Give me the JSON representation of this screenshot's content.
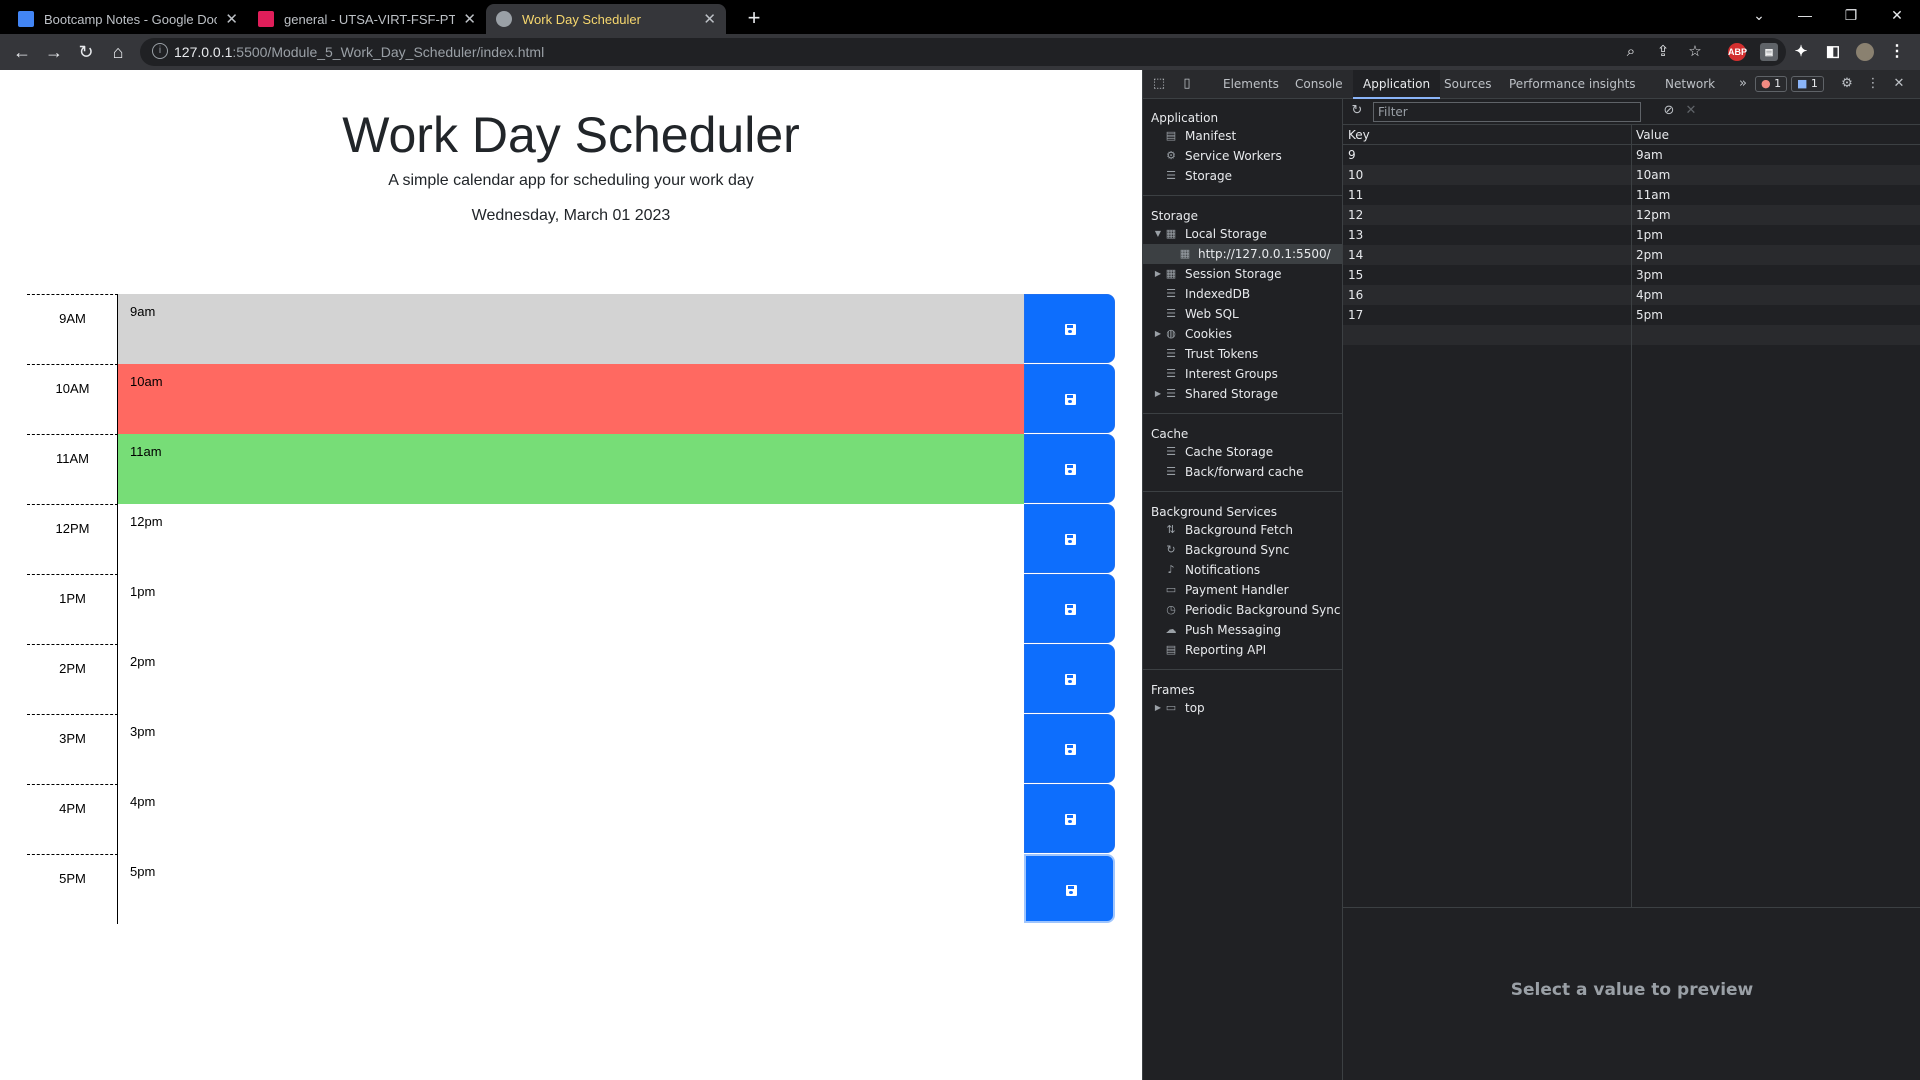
{
  "browser": {
    "tabs": [
      {
        "title": "Bootcamp Notes - Google Docs",
        "favicon_color": "#4285f4"
      },
      {
        "title": "general - UTSA-VIRT-FSF-PT-01-",
        "favicon_color": "#e01e5a"
      },
      {
        "title": "Work Day Scheduler",
        "favicon_color": "#9aa0a6"
      }
    ],
    "url_host": "127.0.0.1",
    "url_rest": ":5500/Module_5_Work_Day_Scheduler/index.html"
  },
  "page": {
    "title": "Work Day Scheduler",
    "subtitle": "A simple calendar app for scheduling your work day",
    "date": "Wednesday, March 01 2023",
    "rows": [
      {
        "hour": "9AM",
        "text": "9am",
        "state": "past"
      },
      {
        "hour": "10AM",
        "text": "10am",
        "state": "present"
      },
      {
        "hour": "11AM",
        "text": "11am",
        "state": "future"
      },
      {
        "hour": "12PM",
        "text": "12pm",
        "state": "none"
      },
      {
        "hour": "1PM",
        "text": "1pm",
        "state": "none"
      },
      {
        "hour": "2PM",
        "text": "2pm",
        "state": "none"
      },
      {
        "hour": "3PM",
        "text": "3pm",
        "state": "none"
      },
      {
        "hour": "4PM",
        "text": "4pm",
        "state": "none"
      },
      {
        "hour": "5PM",
        "text": "5pm",
        "state": "none"
      }
    ],
    "colors": {
      "past": "#d3d3d3",
      "present": "#ff6961",
      "future": "#77dd77",
      "save": "#0d6efd"
    }
  },
  "devtools": {
    "tabs": [
      "Elements",
      "Console",
      "Application",
      "Sources",
      "Performance insights",
      "Network"
    ],
    "active_tab": "Application",
    "error_count": "1",
    "message_count": "1",
    "sections": {
      "application": {
        "title": "Application",
        "items": [
          "Manifest",
          "Service Workers",
          "Storage"
        ]
      },
      "storage": {
        "title": "Storage",
        "items": [
          "Local Storage",
          "http://127.0.0.1:5500/",
          "Session Storage",
          "IndexedDB",
          "Web SQL",
          "Cookies",
          "Trust Tokens",
          "Interest Groups",
          "Shared Storage"
        ]
      },
      "cache": {
        "title": "Cache",
        "items": [
          "Cache Storage",
          "Back/forward cache"
        ]
      },
      "background": {
        "title": "Background Services",
        "items": [
          "Background Fetch",
          "Background Sync",
          "Notifications",
          "Payment Handler",
          "Periodic Background Sync",
          "Push Messaging",
          "Reporting API"
        ]
      },
      "frames": {
        "title": "Frames",
        "items": [
          "top"
        ]
      }
    },
    "filter_placeholder": "Filter",
    "table": {
      "headers": [
        "Key",
        "Value"
      ],
      "rows": [
        [
          "9",
          "9am"
        ],
        [
          "10",
          "10am"
        ],
        [
          "11",
          "11am"
        ],
        [
          "12",
          "12pm"
        ],
        [
          "13",
          "1pm"
        ],
        [
          "14",
          "2pm"
        ],
        [
          "15",
          "3pm"
        ],
        [
          "16",
          "4pm"
        ],
        [
          "17",
          "5pm"
        ]
      ]
    },
    "preview_text": "Select a value to preview"
  }
}
